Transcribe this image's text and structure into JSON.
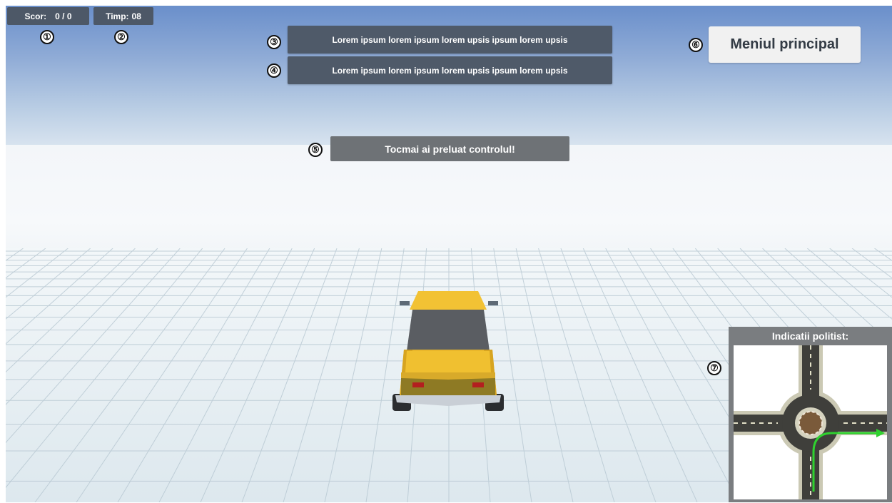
{
  "hud": {
    "score_label": "Scor:",
    "score_value": "0 / 0",
    "time_label": "Timp:",
    "time_value": "08"
  },
  "messages": [
    "Lorem ipsum lorem ipsum lorem upsis ipsum lorem upsis",
    "Lorem ipsum lorem ipsum lorem upsis ipsum lorem upsis"
  ],
  "notice": "Tocmai ai preluat controlul!",
  "menu_button": "Meniul principal",
  "police_panel": {
    "title": "Indicatii politist:"
  },
  "callouts": [
    "①",
    "②",
    "③",
    "④",
    "⑤",
    "⑥",
    "⑦"
  ],
  "colors": {
    "hud_bg": "#4d5867",
    "car_yellow": "#f0c030",
    "route_green": "#2fd12f"
  }
}
